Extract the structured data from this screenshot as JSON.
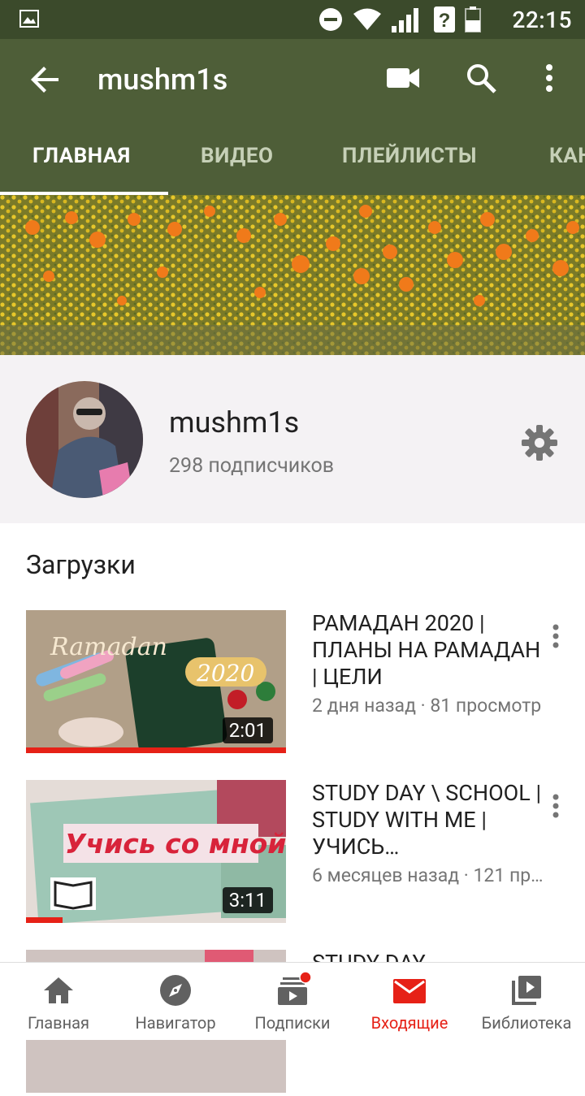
{
  "status_bar": {
    "time": "22:15"
  },
  "app_bar": {
    "title": "mushm1s"
  },
  "tabs": [
    {
      "label": "ГЛАВНАЯ",
      "active": true
    },
    {
      "label": "ВИДЕО",
      "active": false
    },
    {
      "label": "ПЛЕЙЛИСТЫ",
      "active": false
    },
    {
      "label": "КАНАЛЫ",
      "active": false
    }
  ],
  "channel": {
    "name": "mushm1s",
    "subscribers": "298 подписчиков"
  },
  "uploads": {
    "section_title": "Загрузки",
    "videos": [
      {
        "title": "РАМАДАН 2020 | ПЛАНЫ НА РАМАДАН | ЦЕЛИ",
        "meta": "2 дня назад · 81 просмотр",
        "duration": "2:01",
        "watched_fraction": 1.0
      },
      {
        "title": "STUDY DAY \\ SCHOOL | STUDY WITH ME | УЧИСЬ…",
        "meta": "6 месяцев назад · 121 пр…",
        "duration": "3:11",
        "watched_fraction": 0.14
      },
      {
        "title": "STUDY DAY",
        "meta": "",
        "duration": "",
        "watched_fraction": 0
      }
    ]
  },
  "bottom_nav": [
    {
      "label": "Главная",
      "icon": "home-icon",
      "active": false
    },
    {
      "label": "Навигатор",
      "icon": "compass-icon",
      "active": false
    },
    {
      "label": "Подписки",
      "icon": "subscriptions-icon",
      "active": false,
      "badge": true
    },
    {
      "label": "Входящие",
      "icon": "inbox-icon",
      "active": true
    },
    {
      "label": "Библиотека",
      "icon": "library-icon",
      "active": false
    }
  ],
  "colors": {
    "app_bar": "#4e5e38",
    "status_bar": "#3b4a2b",
    "accent_red": "#e62117"
  }
}
